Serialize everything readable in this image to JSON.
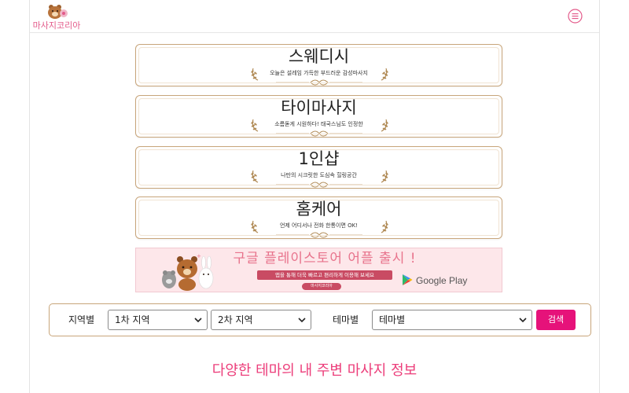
{
  "header": {
    "logo_text": "마사지코리아",
    "menu_icon": "hamburger-menu-icon"
  },
  "categories": [
    {
      "title": "스웨디시",
      "subtitle": "오늘은 설레임 가득한 부드러운 감성마사지"
    },
    {
      "title": "타이마사지",
      "subtitle": "소름돋게 시원하다! 태국스님도 인정한"
    },
    {
      "title": "1인샵",
      "subtitle": "나만의 시크릿한 도심속 힐링공간"
    },
    {
      "title": "홈케어",
      "subtitle": "언제 어디서나 전화 한통이면 OK!"
    }
  ],
  "banner": {
    "title": "구글 플레이스토어 어플 출시 !",
    "subtitle": "앱을 통해 더욱 빠르고 편리하게 이용해 보세요",
    "tag": "마사지코리아",
    "store_name": "Google Play"
  },
  "search": {
    "region_label": "지역별",
    "region1_value": "1차 지역",
    "region2_value": "2차 지역",
    "theme_label": "테마별",
    "theme_value": "테마별",
    "button_label": "검색"
  },
  "section": {
    "title": "다양한 테마의 내 주변 마사지 정보"
  },
  "colors": {
    "brand_pink": "#e6127a",
    "title_pink": "#ec3d7a",
    "gold_border": "#c8a57a",
    "banner_bg": "#fde7ea"
  }
}
